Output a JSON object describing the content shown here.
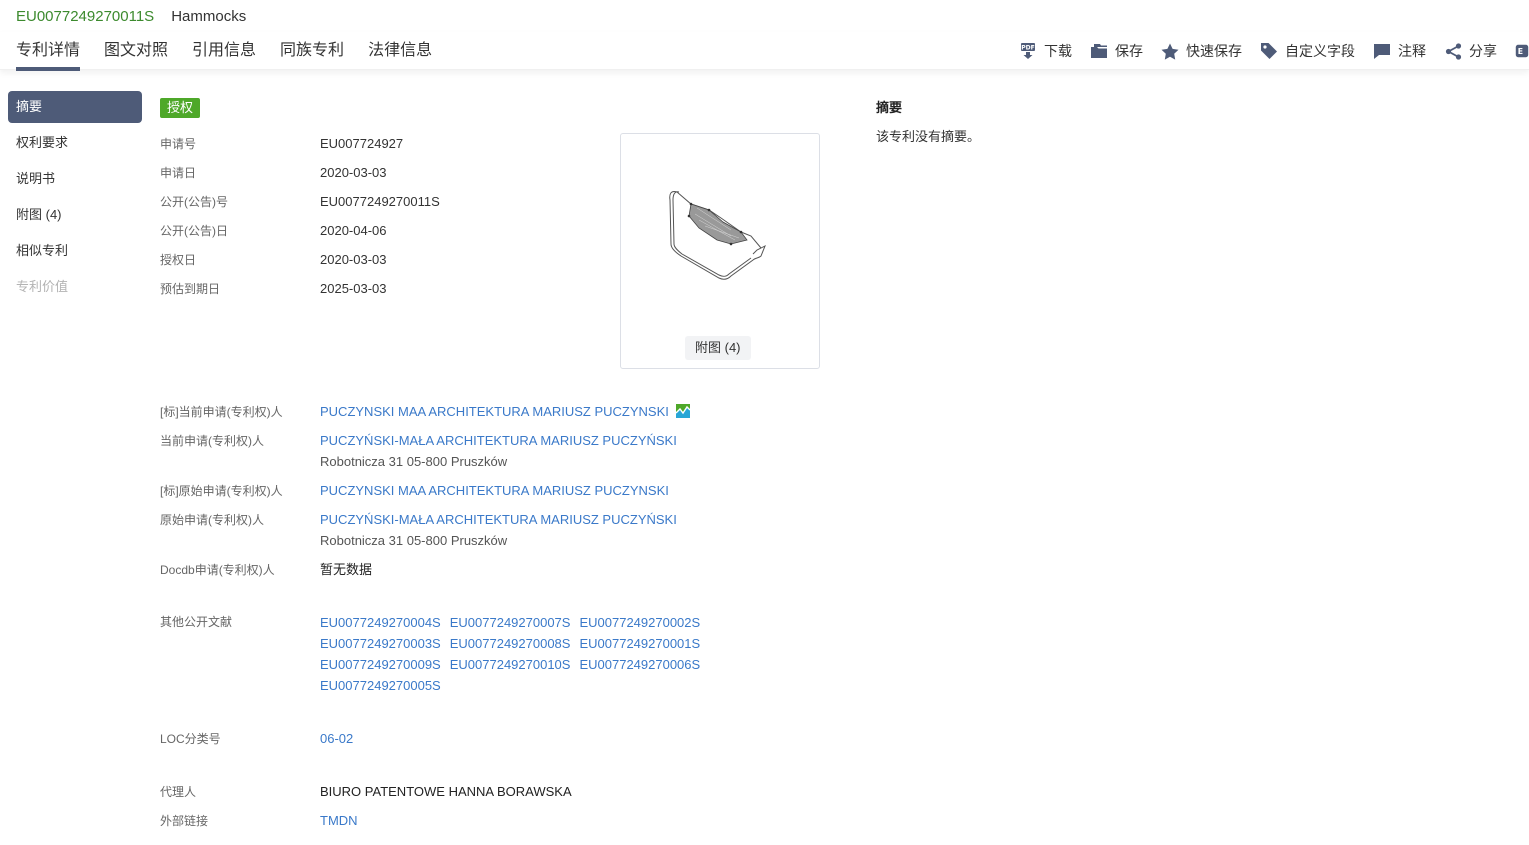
{
  "header": {
    "patent_number": "EU0077249270011S",
    "title": "Hammocks"
  },
  "tabs": [
    {
      "label": "专利详情",
      "active": true
    },
    {
      "label": "图文对照"
    },
    {
      "label": "引用信息"
    },
    {
      "label": "同族专利"
    },
    {
      "label": "法律信息"
    }
  ],
  "toolbar": [
    {
      "icon": "pdf-download-icon",
      "label": "下载"
    },
    {
      "icon": "folder-icon",
      "label": "保存"
    },
    {
      "icon": "star-icon",
      "label": "快速保存"
    },
    {
      "icon": "tag-icon",
      "label": "自定义字段"
    },
    {
      "icon": "comment-icon",
      "label": "注释"
    },
    {
      "icon": "share-icon",
      "label": "分享"
    },
    {
      "icon": "export-icon",
      "label": ""
    }
  ],
  "sidebar": {
    "items": [
      {
        "label": "摘要",
        "active": true
      },
      {
        "label": "权利要求"
      },
      {
        "label": "说明书"
      },
      {
        "label": "附图 (4)"
      },
      {
        "label": "相似专利"
      },
      {
        "label": "专利价值",
        "disabled": true
      }
    ]
  },
  "status_badge": "授权",
  "basic_info": [
    {
      "label": "申请号",
      "value": "EU007724927"
    },
    {
      "label": "申请日",
      "value": "2020-03-03"
    },
    {
      "label": "公开(公告)号",
      "value": "EU0077249270011S"
    },
    {
      "label": "公开(公告)日",
      "value": "2020-04-06"
    },
    {
      "label": "授权日",
      "value": "2020-03-03"
    },
    {
      "label": "预估到期日",
      "value": "2025-03-03"
    }
  ],
  "figure": {
    "label": "附图 (4)"
  },
  "parties": {
    "std_current_applicant": {
      "label": "[标]当前申请(专利权)人",
      "value": "PUCZYNSKI MAA ARCHITEKTURA MARIUSZ PUCZYNSKI"
    },
    "current_applicant": {
      "label": "当前申请(专利权)人",
      "value": "PUCZYŃSKI-MAŁA ARCHITEKTURA MARIUSZ PUCZYŃSKI",
      "address": "Robotnicza 31 05-800 Pruszków"
    },
    "std_original_applicant": {
      "label": "[标]原始申请(专利权)人",
      "value": "PUCZYNSKI MAA ARCHITEKTURA MARIUSZ PUCZYNSKI"
    },
    "original_applicant": {
      "label": "原始申请(专利权)人",
      "value": "PUCZYŃSKI-MAŁA ARCHITEKTURA MARIUSZ PUCZYŃSKI",
      "address": "Robotnicza 31 05-800 Pruszków"
    },
    "docdb_applicant": {
      "label": "Docdb申请(专利权)人",
      "value": "暂无数据"
    }
  },
  "other_publications": {
    "label": "其他公开文献",
    "items": [
      "EU0077249270004S",
      "EU0077249270007S",
      "EU0077249270002S",
      "EU0077249270003S",
      "EU0077249270008S",
      "EU0077249270001S",
      "EU0077249270009S",
      "EU0077249270010S",
      "EU0077249270006S",
      "EU0077249270005S"
    ]
  },
  "loc": {
    "label": "LOC分类号",
    "value": "06-02"
  },
  "agent": {
    "label": "代理人",
    "value": "BIURO PATENTOWE HANNA BORAWSKA"
  },
  "external_link": {
    "label": "外部链接",
    "value": "TMDN"
  },
  "abstract": {
    "heading": "摘要",
    "text": "该专利没有摘要。"
  },
  "colors": {
    "accent": "#4e5b78",
    "link": "#3a79c9",
    "badge_green": "#4ea829",
    "patent_number_green": "#3c8a2e"
  }
}
